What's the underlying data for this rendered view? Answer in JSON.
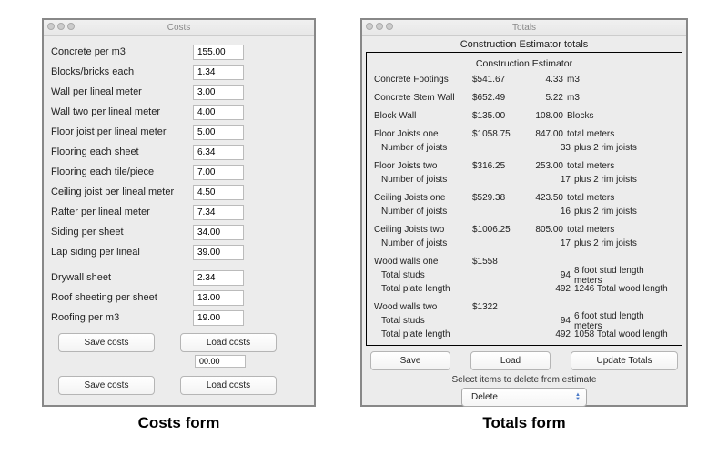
{
  "captions": {
    "left": "Costs form",
    "right": "Totals form"
  },
  "costs_window": {
    "title": "Costs",
    "rows": [
      {
        "label": "Concrete per  m3",
        "value": "155.00"
      },
      {
        "label": "Blocks/bricks each",
        "value": "1.34"
      },
      {
        "label": "Wall per lineal meter",
        "value": "3.00"
      },
      {
        "label": "Wall two per lineal meter",
        "value": "4.00"
      },
      {
        "label": "Floor joist per lineal meter",
        "value": "5.00"
      },
      {
        "label": "Flooring each sheet",
        "value": "6.34"
      },
      {
        "label": "Flooring each tile/piece",
        "value": "7.00"
      },
      {
        "label": "Ceiling joist per lineal meter",
        "value": "4.50"
      },
      {
        "label": "Rafter per lineal meter",
        "value": "7.34"
      },
      {
        "label": "Siding per  sheet",
        "value": "34.00"
      },
      {
        "label": "Lap siding per lineal",
        "value": "39.00"
      },
      {
        "label": "Drywall  sheet",
        "value": "2.34",
        "gap": true
      },
      {
        "label": "Roof sheeting per sheet",
        "value": "13.00"
      },
      {
        "label": "Roofing per  m3",
        "value": "19.00"
      }
    ],
    "buttons": {
      "save": "Save costs",
      "load": "Load costs"
    },
    "stray_value": "00.00"
  },
  "totals_window": {
    "title": "Totals",
    "subheader": "Construction Estimator totals",
    "report_title": "Construction Estimator",
    "lines": [
      {
        "c1": "Concrete  Footings",
        "c2": "$541.67",
        "c3": "4.33",
        "c4": "m3"
      },
      {
        "gap": true
      },
      {
        "c1": "Concrete  Stem Wall",
        "c2": "$652.49",
        "c3": "5.22",
        "c4": "m3"
      },
      {
        "gap": true
      },
      {
        "c1": "Block Wall",
        "c2": "$135.00",
        "c3": "108.00",
        "c4": "Blocks"
      },
      {
        "gap": true
      },
      {
        "c1": "Floor Joists  one",
        "c2": "$1058.75",
        "c3": "847.00",
        "c4": "total meters"
      },
      {
        "c1": "Number of joists",
        "sub": true,
        "c2": "",
        "c3": "33",
        "c4": "plus 2 rim joists"
      },
      {
        "gap": true
      },
      {
        "c1": "Floor Joists  two",
        "c2": "$316.25",
        "c3": "253.00",
        "c4": "total meters"
      },
      {
        "c1": "Number of joists",
        "sub": true,
        "c2": "",
        "c3": "17",
        "c4": "plus 2 rim joists"
      },
      {
        "gap": true
      },
      {
        "c1": "Ceiling Joists one",
        "c2": "$529.38",
        "c3": "423.50",
        "c4": "total meters"
      },
      {
        "c1": "Number of joists",
        "sub": true,
        "c2": "",
        "c3": "16",
        "c4": "plus 2 rim joists"
      },
      {
        "gap": true
      },
      {
        "c1": "Ceiling Joists two",
        "c2": "$1006.25",
        "c3": "805.00",
        "c4": "total meters"
      },
      {
        "c1": "Number of joists",
        "sub": true,
        "c2": "",
        "c3": "17",
        "c4": "plus 2 rim joists"
      },
      {
        "gap": true
      },
      {
        "c1": "Wood walls one",
        "c2": "$1558",
        "c3": "",
        "c4": ""
      },
      {
        "c1": "Total studs",
        "sub": true,
        "c2": "",
        "c3": "94",
        "c4": "8   foot stud length meters"
      },
      {
        "c1": "Total plate length",
        "sub": true,
        "c2": "",
        "c3": "492",
        "c4": "1246  Total wood length"
      },
      {
        "gap": true
      },
      {
        "c1": "Wood walls two",
        "c2": "$1322",
        "c3": "",
        "c4": ""
      },
      {
        "c1": "Total studs",
        "sub": true,
        "c2": "",
        "c3": "94",
        "c4": "6   foot stud length meters"
      },
      {
        "c1": "Total plate length",
        "sub": true,
        "c2": "",
        "c3": "492",
        "c4": "1058  Total wood length"
      }
    ],
    "buttons": {
      "save": "Save",
      "load": "Load",
      "update": "Update Totals"
    },
    "select_caption": "Select items to delete from estimate",
    "select_value": "Delete"
  }
}
